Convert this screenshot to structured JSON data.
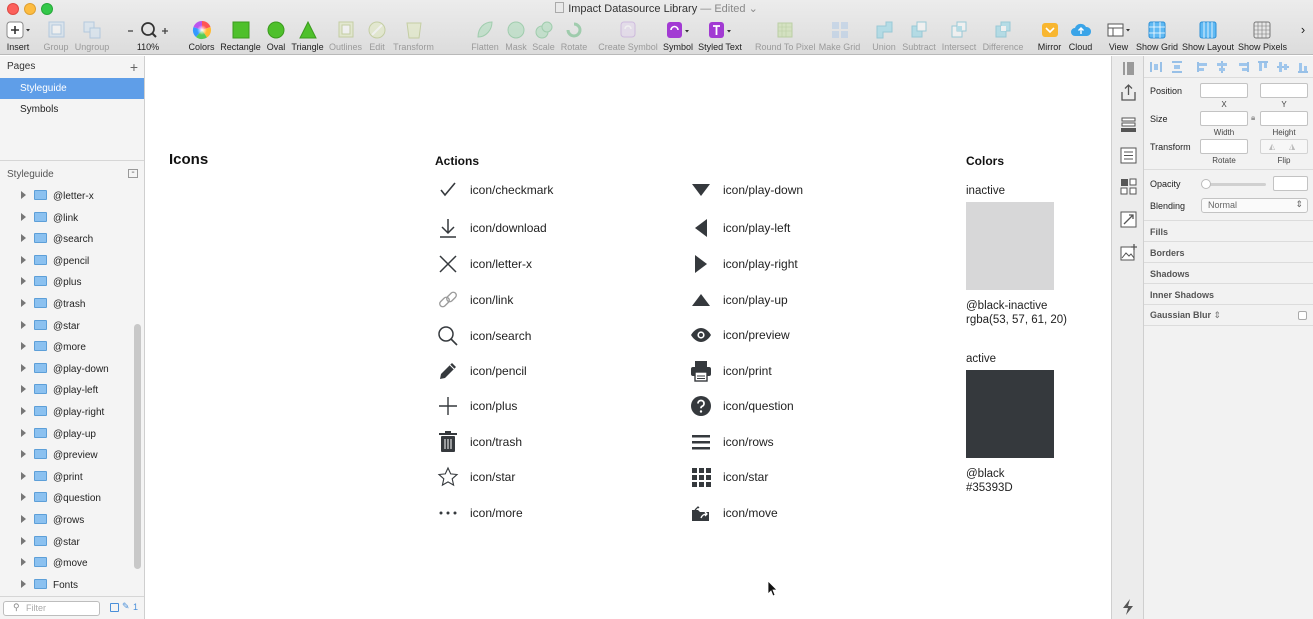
{
  "window": {
    "title": "Impact Datasource Library",
    "edited": "— Edited"
  },
  "toolbar": {
    "insert": "Insert",
    "group": "Group",
    "ungroup": "Ungroup",
    "zoom": "110%",
    "colors": "Colors",
    "rectangle": "Rectangle",
    "oval": "Oval",
    "triangle": "Triangle",
    "outlines": "Outlines",
    "edit": "Edit",
    "transform": "Transform",
    "flatten": "Flatten",
    "mask": "Mask",
    "scale": "Scale",
    "rotate": "Rotate",
    "create_symbol": "Create Symbol",
    "symbol": "Symbol",
    "styled_text": "Styled Text",
    "round_to_pixel": "Round To Pixel",
    "make_grid": "Make Grid",
    "union": "Union",
    "subtract": "Subtract",
    "intersect": "Intersect",
    "difference": "Difference",
    "mirror": "Mirror",
    "cloud": "Cloud",
    "view": "View",
    "show_grid": "Show Grid",
    "show_layout": "Show Layout",
    "show_pixels": "Show Pixels"
  },
  "sidebar": {
    "pages_header": "Pages",
    "pages": [
      {
        "label": "Styleguide"
      },
      {
        "label": "Symbols"
      }
    ],
    "layers_header": "Styleguide",
    "layers": [
      {
        "label": "@letter-x"
      },
      {
        "label": "@link"
      },
      {
        "label": "@search"
      },
      {
        "label": "@pencil"
      },
      {
        "label": "@plus"
      },
      {
        "label": "@trash"
      },
      {
        "label": "@star"
      },
      {
        "label": "@more"
      },
      {
        "label": "@play-down"
      },
      {
        "label": "@play-left"
      },
      {
        "label": "@play-right"
      },
      {
        "label": "@play-up"
      },
      {
        "label": "@preview"
      },
      {
        "label": "@print"
      },
      {
        "label": "@question"
      },
      {
        "label": "@rows"
      },
      {
        "label": "@star"
      },
      {
        "label": "@move"
      },
      {
        "label": "Fonts"
      }
    ],
    "filter_placeholder": "Filter",
    "filter_count": "1"
  },
  "canvas": {
    "title": "Icons",
    "actions_heading": "Actions",
    "colors_heading": "Colors",
    "icons_left": [
      {
        "name": "icon/checkmark",
        "icon": "checkmark-icon"
      },
      {
        "name": "icon/download",
        "icon": "download-icon"
      },
      {
        "name": "icon/letter-x",
        "icon": "letter-x-icon"
      },
      {
        "name": "icon/link",
        "icon": "link-icon"
      },
      {
        "name": "icon/search",
        "icon": "search-icon"
      },
      {
        "name": "icon/pencil",
        "icon": "pencil-icon"
      },
      {
        "name": "icon/plus",
        "icon": "plus-icon"
      },
      {
        "name": "icon/trash",
        "icon": "trash-icon"
      },
      {
        "name": "icon/star",
        "icon": "star-outline-icon"
      },
      {
        "name": "icon/more",
        "icon": "more-icon"
      }
    ],
    "icons_right": [
      {
        "name": "icon/play-down",
        "icon": "play-down-icon"
      },
      {
        "name": "icon/play-left",
        "icon": "play-left-icon"
      },
      {
        "name": "icon/play-right",
        "icon": "play-right-icon"
      },
      {
        "name": "icon/play-up",
        "icon": "play-up-icon"
      },
      {
        "name": "icon/preview",
        "icon": "eye-icon"
      },
      {
        "name": "icon/print",
        "icon": "printer-icon"
      },
      {
        "name": "icon/question",
        "icon": "question-icon"
      },
      {
        "name": "icon/rows",
        "icon": "rows-icon"
      },
      {
        "name": "icon/star",
        "icon": "grid-icon"
      },
      {
        "name": "icon/move",
        "icon": "move-folder-icon"
      }
    ],
    "colors": {
      "inactive": {
        "label": "inactive",
        "name": "@black-inactive",
        "value": "rgba(53, 57, 61, 20)",
        "swatch": "#d7d7d8"
      },
      "active": {
        "label": "active",
        "name": "@black",
        "value": "#35393D",
        "swatch": "#35393d"
      }
    }
  },
  "inspector": {
    "position": "Position",
    "x": "X",
    "y": "Y",
    "size": "Size",
    "width": "Width",
    "height": "Height",
    "transform": "Transform",
    "rotate": "Rotate",
    "flip": "Flip",
    "opacity": "Opacity",
    "blending": "Blending",
    "blending_value": "Normal",
    "fills": "Fills",
    "borders": "Borders",
    "shadows": "Shadows",
    "inner_shadows": "Inner Shadows",
    "gaussian_blur": "Gaussian Blur"
  },
  "theme": {
    "accent": "#5f9ee8",
    "icon_color": "#35393d"
  }
}
